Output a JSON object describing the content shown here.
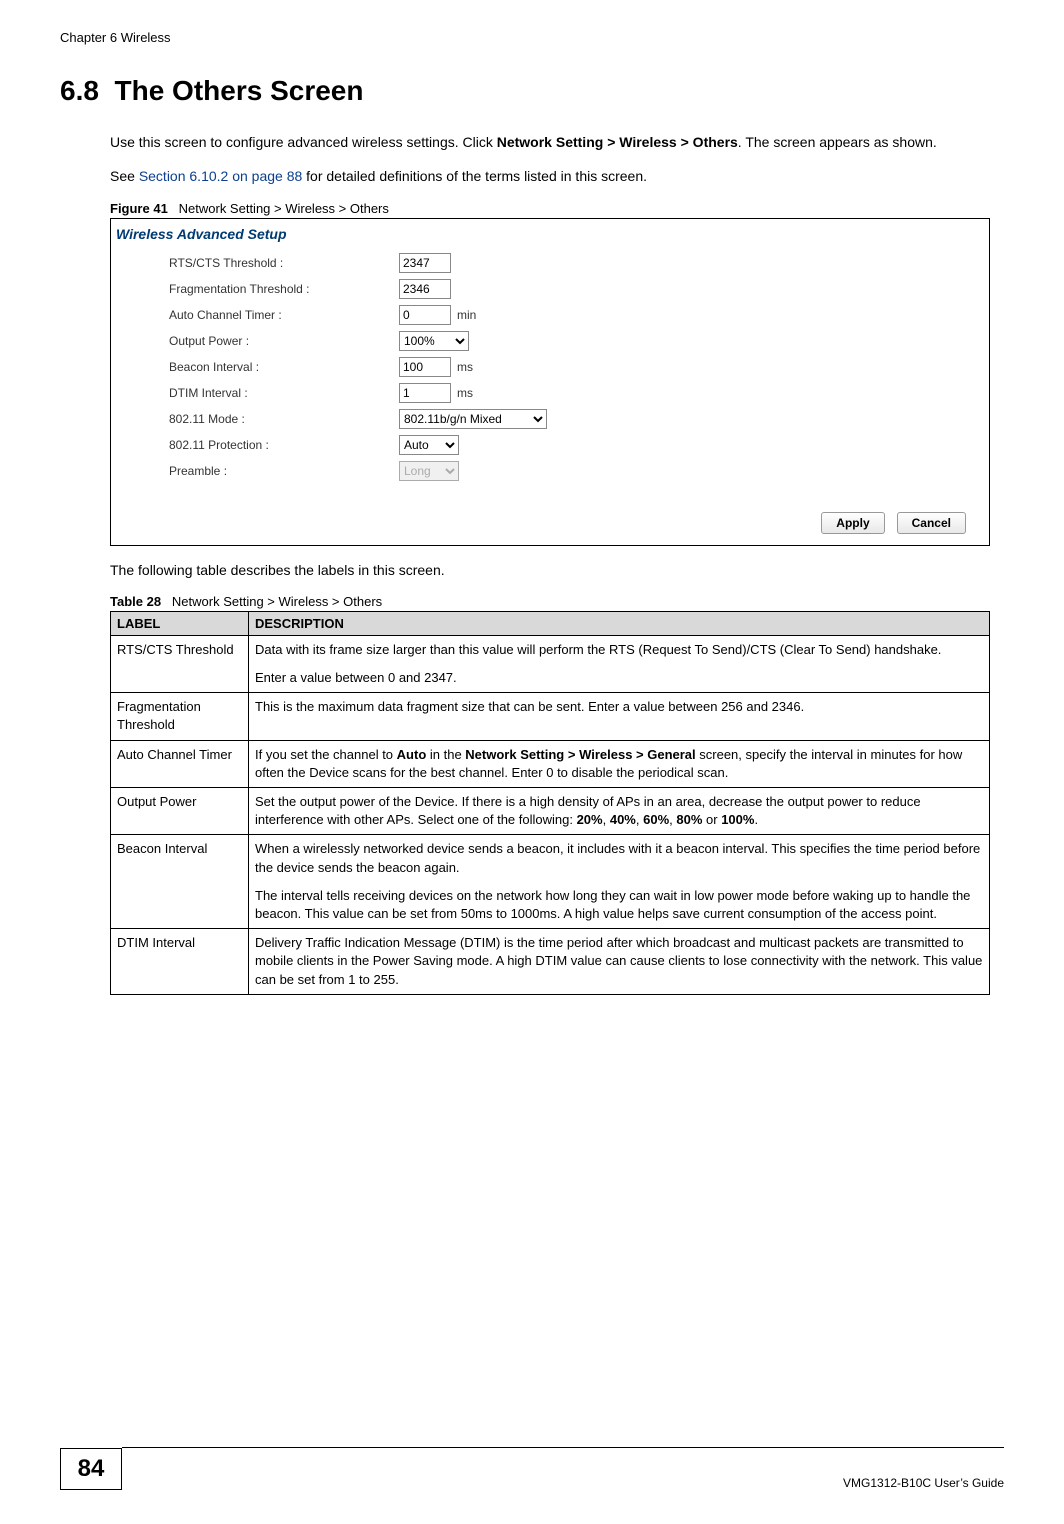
{
  "header": {
    "chapter": "Chapter 6 Wireless"
  },
  "section": {
    "number": "6.8",
    "title": "The Others Screen",
    "intro_a": "Use this screen to configure advanced wireless settings. Click ",
    "intro_b_bold": "Network Setting > Wireless > Others",
    "intro_c": ". The screen appears as shown.",
    "see_a": "See ",
    "see_link": "Section 6.10.2 on page 88",
    "see_b": " for detailed definitions of the terms listed in this screen."
  },
  "figure": {
    "label": "Figure 41",
    "caption": "Network Setting > Wireless > Others",
    "panel_title": "Wireless Advanced Setup",
    "rows": {
      "rts": {
        "label": "RTS/CTS Threshold :",
        "value": "2347"
      },
      "frag": {
        "label": "Fragmentation Threshold :",
        "value": "2346"
      },
      "act": {
        "label": "Auto Channel Timer :",
        "value": "0",
        "unit": "min"
      },
      "power": {
        "label": "Output Power :",
        "value": "100%"
      },
      "beacon": {
        "label": "Beacon Interval :",
        "value": "100",
        "unit": "ms"
      },
      "dtim": {
        "label": "DTIM Interval :",
        "value": "1",
        "unit": "ms"
      },
      "mode": {
        "label": "802.11 Mode :",
        "value": "802.11b/g/n Mixed"
      },
      "protection": {
        "label": "802.11 Protection :",
        "value": "Auto"
      },
      "preamble": {
        "label": "Preamble :",
        "value": "Long"
      }
    },
    "buttons": {
      "apply": "Apply",
      "cancel": "Cancel"
    }
  },
  "after_fig": "The following table describes the labels in this screen.",
  "table": {
    "label": "Table 28",
    "caption": "Network Setting > Wireless > Others",
    "head": {
      "c1": "LABEL",
      "c2": "DESCRIPTION"
    },
    "rows": [
      {
        "label": "RTS/CTS Threshold",
        "desc1": "Data with its frame size larger than this value will perform the RTS (Request To Send)/CTS (Clear To Send) handshake.",
        "desc2": "Enter a value between 0 and 2347."
      },
      {
        "label": "Fragmentation Threshold",
        "desc1": "This is the maximum data fragment size that can be sent. Enter a value between 256 and 2346."
      },
      {
        "label": "Auto Channel Timer",
        "seg": [
          {
            "t": "plain",
            "v": "If you set the channel to "
          },
          {
            "t": "bold",
            "v": "Auto"
          },
          {
            "t": "plain",
            "v": " in the "
          },
          {
            "t": "bold",
            "v": "Network Setting > Wireless > General"
          },
          {
            "t": "plain",
            "v": " screen, specify the interval in minutes for how often the Device scans for the best channel. Enter 0 to disable the periodical scan."
          }
        ]
      },
      {
        "label": "Output Power",
        "seg": [
          {
            "t": "plain",
            "v": "Set the output power of the Device. If there is a high density of APs in an area, decrease the output power to reduce interference with other APs. Select one of the following: "
          },
          {
            "t": "bold",
            "v": "20%"
          },
          {
            "t": "plain",
            "v": ", "
          },
          {
            "t": "bold",
            "v": "40%"
          },
          {
            "t": "plain",
            "v": ", "
          },
          {
            "t": "bold",
            "v": "60%"
          },
          {
            "t": "plain",
            "v": ", "
          },
          {
            "t": "bold",
            "v": "80%"
          },
          {
            "t": "plain",
            "v": " or "
          },
          {
            "t": "bold",
            "v": "100%"
          },
          {
            "t": "plain",
            "v": "."
          }
        ]
      },
      {
        "label": "Beacon Interval",
        "desc1": "When a wirelessly networked device sends a beacon, it includes with it a beacon interval. This specifies the time period before the device sends the beacon again.",
        "desc2": "The interval tells receiving devices on the network how long they can wait in low power mode before waking up to handle the beacon. This value can be set from 50ms to 1000ms. A high value helps save current consumption of the access point."
      },
      {
        "label": "DTIM Interval",
        "desc1": "Delivery Traffic Indication Message (DTIM) is the time period after which broadcast and multicast packets are transmitted to mobile clients in the Power Saving mode. A high DTIM value can cause clients to lose connectivity with the network. This value can be set from 1 to 255."
      }
    ]
  },
  "footer": {
    "page": "84",
    "guide": "VMG1312-B10C User’s Guide"
  }
}
